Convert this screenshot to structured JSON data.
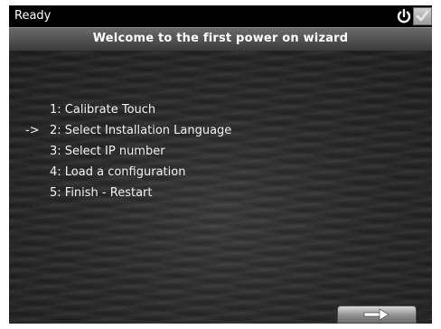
{
  "status_bar": {
    "status": "Ready",
    "power_icon": "power-icon",
    "confirm_icon": "checkmark-icon"
  },
  "wizard": {
    "title": "Welcome to the first power on wizard",
    "current_marker": "->",
    "steps": [
      {
        "label": "1: Calibrate Touch",
        "current": false
      },
      {
        "label": "2: Select Installation Language",
        "current": true
      },
      {
        "label": "3: Select IP number",
        "current": false
      },
      {
        "label": "4: Load a configuration",
        "current": false
      },
      {
        "label": "5: Finish - Restart",
        "current": false
      }
    ],
    "next_icon": "arrow-right-icon"
  },
  "colors": {
    "status_bar": "#000000",
    "title_bar": "#4f4f4f",
    "text": "#ffffff"
  }
}
